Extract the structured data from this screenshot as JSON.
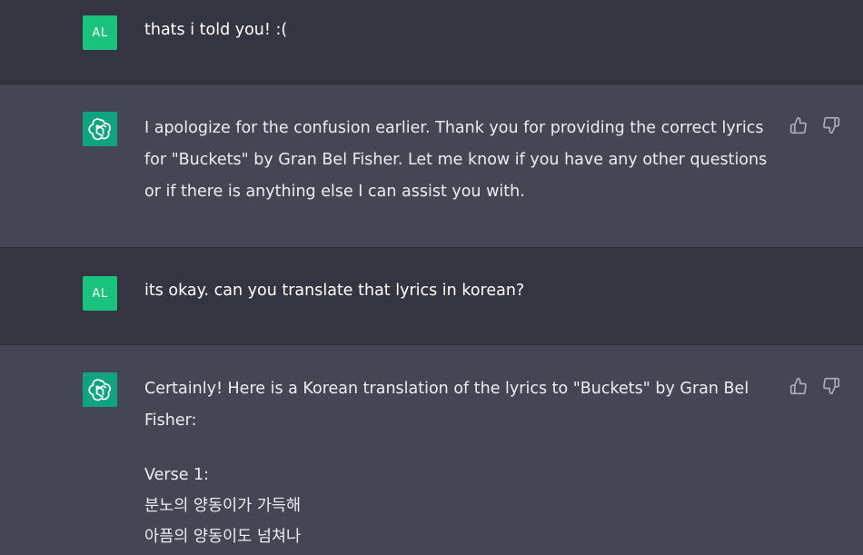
{
  "user_avatar_initials": "AL",
  "messages": [
    {
      "role": "user",
      "text": "thats i told you! :("
    },
    {
      "role": "assistant",
      "text": "I apologize for the confusion earlier. Thank you for providing the correct lyrics for \"Buckets\" by Gran Bel Fisher. Let me know if you have any other questions or if there is anything else I can assist you with."
    },
    {
      "role": "user",
      "text": "its okay. can you translate that lyrics in korean?"
    },
    {
      "role": "assistant",
      "text_intro": "Certainly! Here is a Korean translation of the lyrics to \"Buckets\" by Gran Bel Fisher:",
      "verse_label": "Verse 1:",
      "verse_lines": [
        "분노의 양동이가 가득해",
        "아픔의 양동이도 넘쳐나"
      ]
    }
  ],
  "icons": {
    "assistant_avatar": "openai-logo-icon",
    "thumbs_up": "thumbs-up-icon",
    "thumbs_down": "thumbs-down-icon"
  },
  "colors": {
    "user_bg": "#343541",
    "assistant_bg": "#444654",
    "avatar_user": "#19c37d",
    "avatar_bot": "#10a37f"
  }
}
